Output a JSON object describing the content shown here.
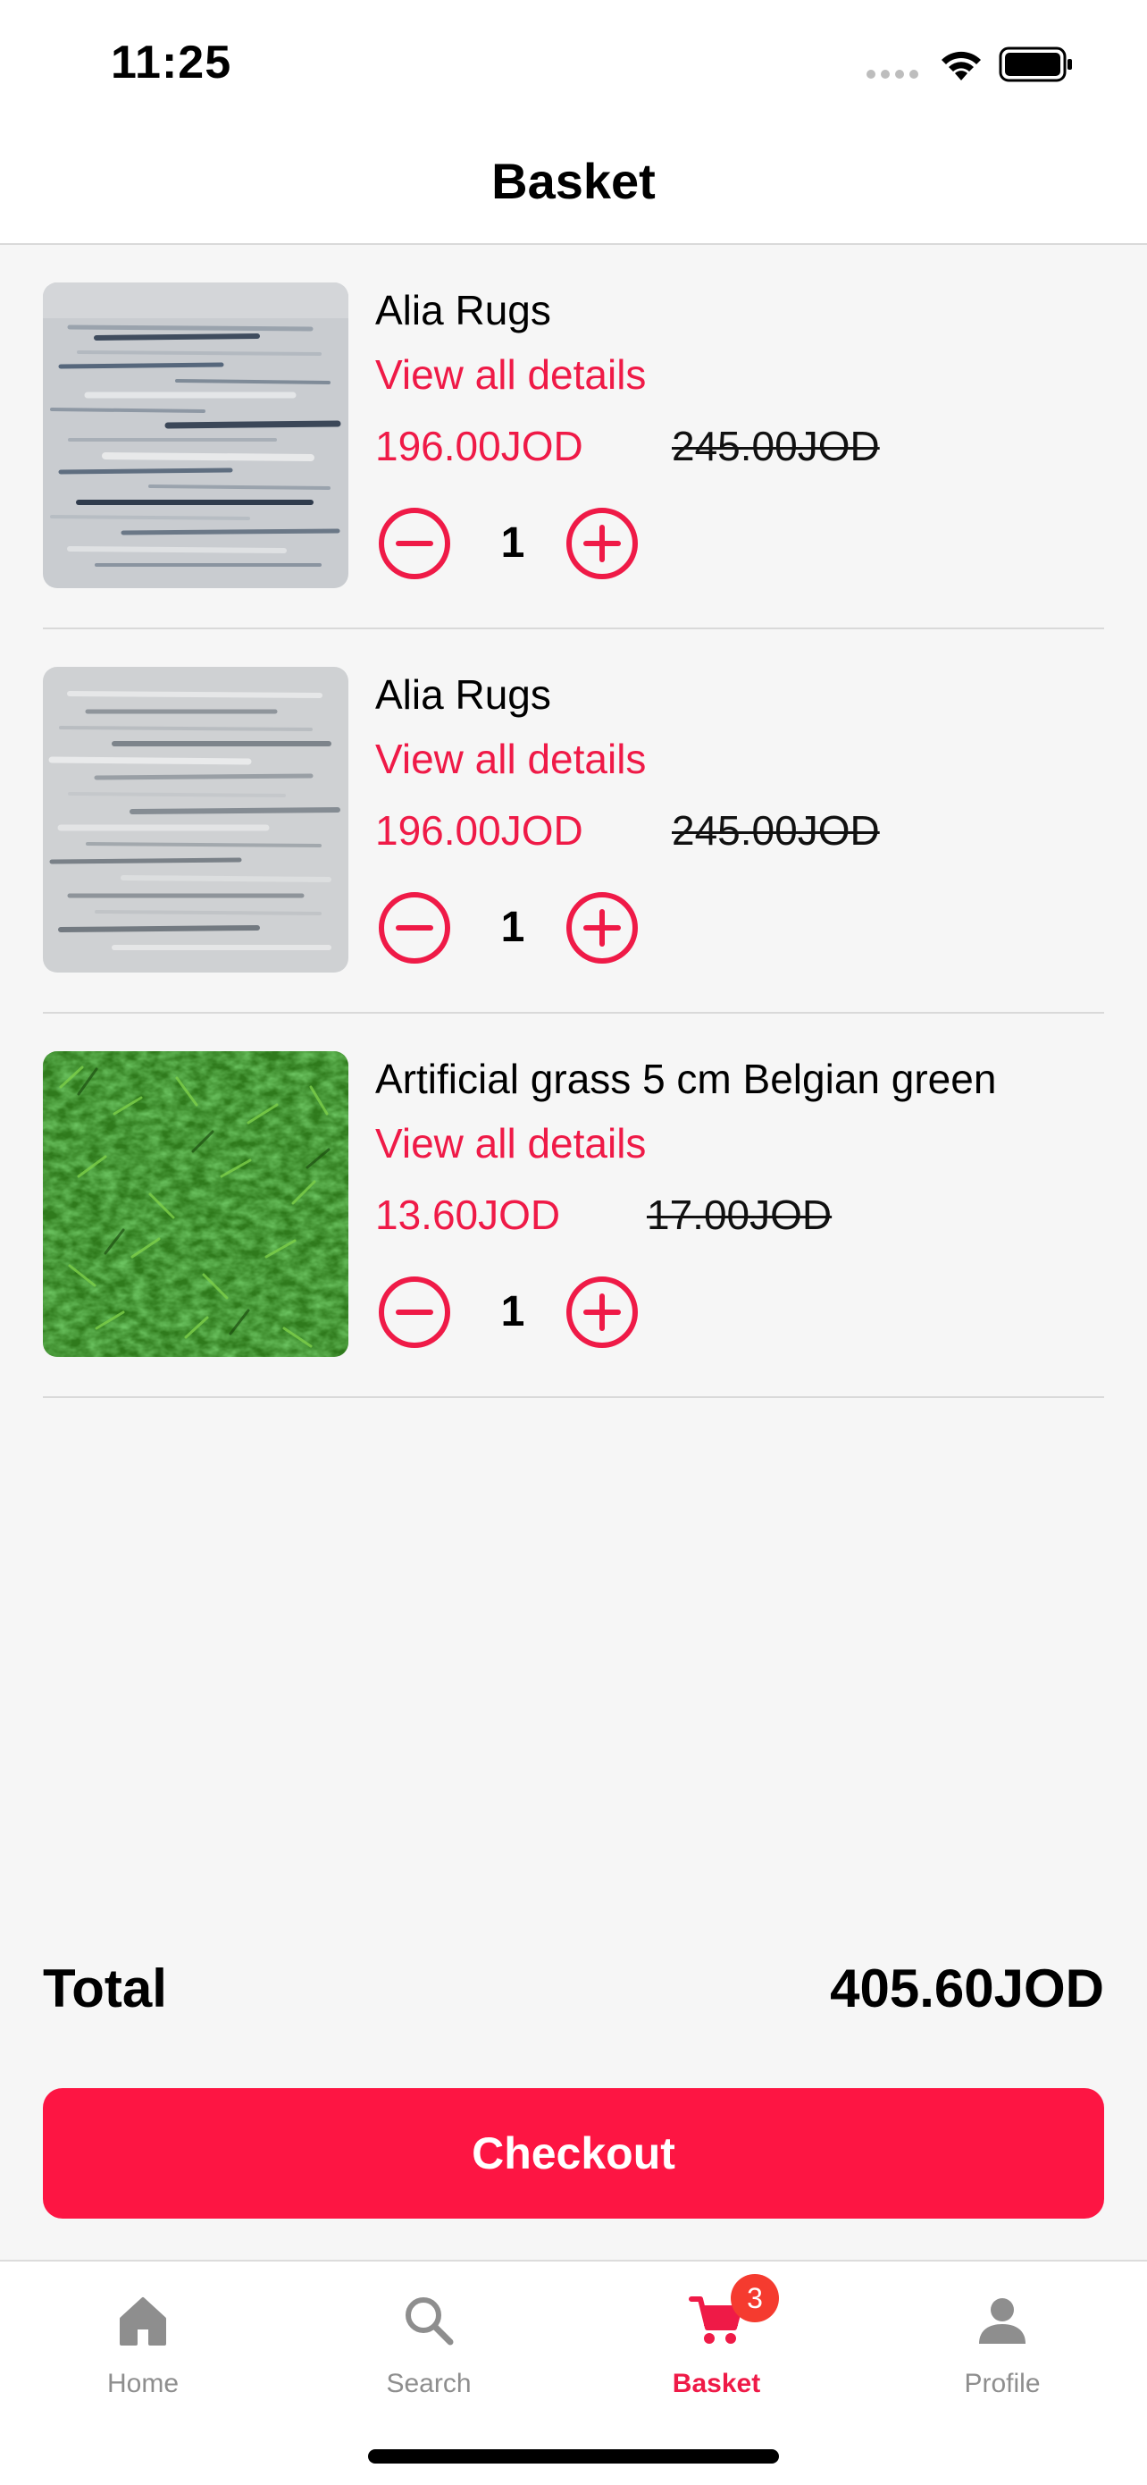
{
  "status_bar": {
    "time": "11:25",
    "icons": [
      "cellular-signal-icon",
      "wifi-icon",
      "battery-icon"
    ]
  },
  "header": {
    "title": "Basket"
  },
  "colors": {
    "accent": "#ef1a47",
    "checkout_button": "#fd1543",
    "badge": "#f53b2f",
    "background": "#f6f6f6"
  },
  "basket": {
    "items": [
      {
        "name": "Alia Rugs",
        "details_link": "View all details",
        "price": "196.00JOD",
        "old_price": "245.00JOD",
        "quantity": "1",
        "image": "grey-blue-rug-image"
      },
      {
        "name": "Alia Rugs",
        "details_link": "View all details",
        "price": "196.00JOD",
        "old_price": "245.00JOD",
        "quantity": "1",
        "image": "grey-rug-image"
      },
      {
        "name": "Artificial grass 5 cm Belgian green",
        "details_link": "View all details",
        "price": "13.60JOD",
        "old_price": "17.00JOD",
        "quantity": "1",
        "image": "artificial-grass-image"
      }
    ]
  },
  "summary": {
    "total_label": "Total",
    "total_value": "405.60JOD",
    "checkout_label": "Checkout"
  },
  "tab_bar": {
    "tabs": [
      {
        "label": "Home",
        "icon": "home-icon",
        "active": false
      },
      {
        "label": "Search",
        "icon": "search-icon",
        "active": false
      },
      {
        "label": "Basket",
        "icon": "cart-icon",
        "active": true,
        "badge": "3"
      },
      {
        "label": "Profile",
        "icon": "profile-icon",
        "active": false
      }
    ]
  }
}
